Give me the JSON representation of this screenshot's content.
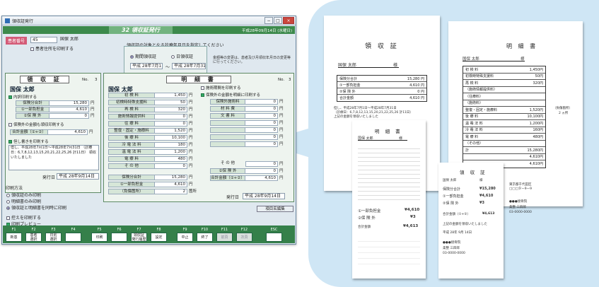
{
  "window": {
    "title": "領収証発行",
    "min": "−",
    "max": "□",
    "close": "×"
  },
  "header": {
    "title": "32 領収証発行",
    "date": "平成28年09月14日 (水曜日)"
  },
  "patient": {
    "label": "患者番号",
    "id": "45",
    "name": "国保 太郎",
    "address_print": "患者住所を印刷する"
  },
  "period": {
    "title": "領収証の対象となる診療年月日を指定してください",
    "opt1": "期間領収証",
    "opt2": "日領収証",
    "from": "平成 28年7月1日",
    "tilde": "〜",
    "to": "平成 28年7月31日"
  },
  "notice": "金額等の変更は、患者及び月領収年月日の変更等に行ってください。",
  "receipt": {
    "title": "領 収 証",
    "no_label": "No.",
    "no": "3",
    "name": "国保 太郎",
    "print_chk": "内訳印刷する",
    "rows": [
      {
        "k": "保険分合計",
        "v": "15,280",
        "u": "円"
      },
      {
        "k": "①一部負担金",
        "v": "4,610",
        "u": "円"
      },
      {
        "k": "②保 険 外",
        "v": "0",
        "u": "円"
      }
    ],
    "opt_chk": "保険外の金額も領収印刷する",
    "total_k": "合計金額（①+②）",
    "total_v": "4,610",
    "total_u": "円",
    "note_chk": "但し書きを印刷する",
    "note": "但し、平成28年7月1日〜平成28年7月31日 （診療日：6,7,8,12,13,15,20,21,22,25,26 計11日） 領収いたしました",
    "issue_label": "発行日",
    "issue": "平成 28年9月14日"
  },
  "detail": {
    "title": "明 細 書",
    "no_label": "No.",
    "no": "3",
    "name": "国保 太郎",
    "rows": [
      {
        "k": "初 検 料",
        "v": "1,450",
        "u": "円"
      },
      {
        "k": "初検時特殊支援料",
        "v": "50",
        "u": "円"
      },
      {
        "k": "再 検 料",
        "v": "320",
        "u": "円"
      },
      {
        "k": "施術情報提供料",
        "v": "0",
        "u": "円"
      },
      {
        "k": "往 療 料",
        "v": "0",
        "u": "円"
      },
      {
        "k": "整復・固定・施療料",
        "v": "1,520",
        "u": "円"
      },
      {
        "k": "後 療 料",
        "v": "10,100",
        "u": "円"
      },
      {
        "k": "冷 電 法 料",
        "v": "180",
        "u": "円"
      },
      {
        "k": "温 電 法 料",
        "v": "1,200",
        "u": "円"
      },
      {
        "k": "電 療 料",
        "v": "480",
        "u": "円"
      },
      {
        "k": "そ の 他",
        "v": "0",
        "u": "円"
      },
      {
        "k": "保険分合計",
        "v": "15,280",
        "u": "円"
      },
      {
        "k": "①一部負担金",
        "v": "4,610",
        "u": "円"
      },
      {
        "k": "（負傷箇所）",
        "v": "2",
        "u": "箇所"
      }
    ],
    "chk1": "施術期間を印刷する",
    "chk2": "保険外の金額を明細に印刷する",
    "right_rows": [
      {
        "k": "保険外施術料",
        "v": "0",
        "u": "円"
      },
      {
        "k": "材 料 費",
        "v": "0",
        "u": "円"
      },
      {
        "k": "文 書 料",
        "v": "0",
        "u": "円"
      },
      {
        "k": "",
        "v": "0",
        "u": "円"
      },
      {
        "k": "",
        "v": "0",
        "u": "円"
      },
      {
        "k": "",
        "v": "0",
        "u": "円"
      },
      {
        "k": "",
        "v": "0",
        "u": "円"
      }
    ],
    "other_k": "そ の 他",
    "other_v": "0",
    "other_u": "円",
    "gai_k": "②保 険 外",
    "gai_v": "0",
    "gai_u": "円",
    "total_k": "合計金額（①+②）",
    "total_v": "4,610",
    "total_u": "円",
    "issue_label": "発行日",
    "issue": "平成 28年9月14日"
  },
  "print": {
    "title": "印刷方法",
    "o1": "領収証のみ印刷",
    "o2": "明細書のみ印刷",
    "o3": "領収証と明細書を同時に印刷",
    "c1": "控えを印刷する",
    "c2": "印刷プレビュー"
  },
  "item_edit": "項目名編集",
  "fkeys": [
    {
      "k": "F1",
      "l": "新患"
    },
    {
      "k": "F2",
      "l": "患者\n選択"
    },
    {
      "k": "F3",
      "l": "日別\n選択"
    },
    {
      "k": "F4",
      "l": ""
    },
    {
      "k": "F5",
      "l": "印刷"
    },
    {
      "k": "F6",
      "l": ""
    },
    {
      "k": "F7",
      "l": "領収証\n発行履歴"
    },
    {
      "k": "F8",
      "l": "設定"
    },
    {
      "k": "F9",
      "l": "中止"
    },
    {
      "k": "F10",
      "l": "終了"
    },
    {
      "k": "F11",
      "l": "前頁"
    },
    {
      "k": "F12",
      "l": "次頁"
    },
    {
      "k": "ESC",
      "l": ""
    }
  ],
  "paper1": {
    "title": "領 収 証",
    "name": "国保 太郎",
    "sama": "様",
    "rows": [
      {
        "k": "保険分合計",
        "v": "15,280 円"
      },
      {
        "k": "①一部負担金",
        "v": "4,610 円"
      },
      {
        "k": "②保 険 外",
        "v": "0 円"
      },
      {
        "k": "合計金額",
        "v": "4,610 円"
      }
    ],
    "note": "但し、平成28年7月1日〜平成28年7月31日",
    "note2": "（診療日：6,7,8,12,13,15,20,21,22,25,26 計11日）",
    "note3": "上記の金額を領収いたしました"
  },
  "paper2": {
    "title": "明 細 書",
    "name": "国保 太郎",
    "sama": "様",
    "rows": [
      {
        "k": "初 検 料",
        "v": "1,450円"
      },
      {
        "k": "初検時特殊支援料",
        "v": "50円"
      },
      {
        "k": "再 検 料",
        "v": "320円"
      },
      {
        "k": "（施術情報提供料）",
        "v": ""
      },
      {
        "k": "（往療料）",
        "v": ""
      },
      {
        "k": "（施術料）",
        "v": ""
      },
      {
        "k": "整復・固定・施療料",
        "v": "1,520円"
      },
      {
        "k": "後 療 料",
        "v": "10,100円"
      },
      {
        "k": "温 罨 法 料",
        "v": "1,200円"
      },
      {
        "k": "冷 罨 法 料",
        "v": "160円"
      },
      {
        "k": "電 療 料",
        "v": "480円"
      },
      {
        "k": "（その他）",
        "v": ""
      },
      {
        "k": "計",
        "v": "15,280円"
      },
      {
        "k": "",
        "v": "4,610円"
      },
      {
        "k": "",
        "v": "4,610円"
      }
    ],
    "side1": "（負傷箇所）",
    "side2": "2 ヵ所"
  },
  "paper3": {
    "title": "明 細 書",
    "name": "国保 太郎",
    "sama": "様",
    "total_label": "合計金額",
    "total": "¥4,613",
    "pay": "①一部負担金",
    "pay_v": "¥4,610",
    "gai": "②保 険 外",
    "gai_v": "¥3"
  },
  "paper4": {
    "title": "領 収 証",
    "name": "国保 太郎",
    "sama": "様",
    "rows": [
      {
        "k": "保険分合計",
        "v": "¥15,280"
      },
      {
        "k": "①一部負担金",
        "v": "¥4,610"
      },
      {
        "k": "②保 険 外",
        "v": "¥3"
      }
    ],
    "total_label": "合計金額（①+②）",
    "total": "¥4,613",
    "date": "平成 28年 9月 14日",
    "addr": "東京都千代田区",
    "addr2": "□□□ター9ー9",
    "clinic": "●●●接骨院",
    "person": "柔整 三四郎",
    "tel": "03-0000-0000",
    "note": "上記の金額を領収いたしました"
  }
}
